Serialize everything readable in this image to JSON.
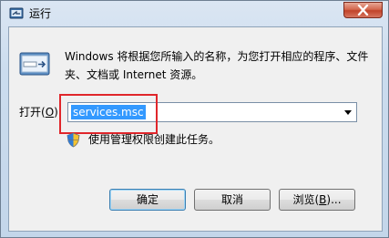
{
  "window": {
    "title": "运行",
    "icon": "run-icon"
  },
  "description": "Windows 将根据您所输入的名称，为您打开相应的程序、文件夹、文档或 Internet 资源。",
  "open_field": {
    "label_prefix": "打开(",
    "label_accel": "O",
    "label_suffix": "):",
    "value": "services.msc"
  },
  "admin_note": "使用管理权限创建此任务。",
  "buttons": {
    "ok": "确定",
    "cancel": "取消",
    "browse_prefix": "浏览(",
    "browse_accel": "B",
    "browse_suffix": ")..."
  },
  "colors": {
    "selection": "#3399ff",
    "highlight_box": "#e0262b",
    "close_button": "#c1432a"
  }
}
